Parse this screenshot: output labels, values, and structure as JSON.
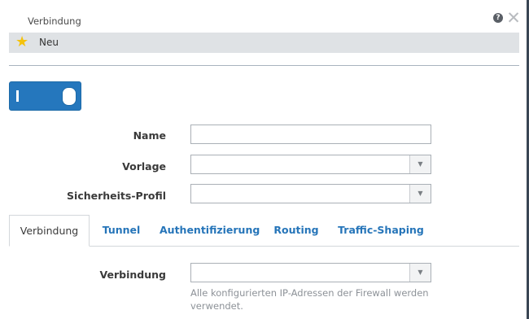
{
  "dialog": {
    "title": "Verbindung",
    "help_icon": "question-circle-icon",
    "close_icon": "close-x-icon"
  },
  "header": {
    "star_icon": "star-icon",
    "name": "Neu"
  },
  "toggle": {
    "state": "on",
    "accent": "#2577bd"
  },
  "form": {
    "name_label": "Name",
    "name_value": "",
    "template_label": "Vorlage",
    "template_value": "",
    "security_label": "Sicherheits-Profil",
    "security_value": ""
  },
  "tabs": [
    {
      "label": "Verbindung",
      "active": true
    },
    {
      "label": "Tunnel",
      "active": false
    },
    {
      "label": "Authentifizierung",
      "active": false
    },
    {
      "label": "Routing",
      "active": false
    },
    {
      "label": "Traffic-Shaping",
      "active": false
    }
  ],
  "connection": {
    "label": "Verbindung",
    "value": "",
    "hint": "Alle konfigurierten IP-Adressen der Firewall werden verwendet."
  }
}
